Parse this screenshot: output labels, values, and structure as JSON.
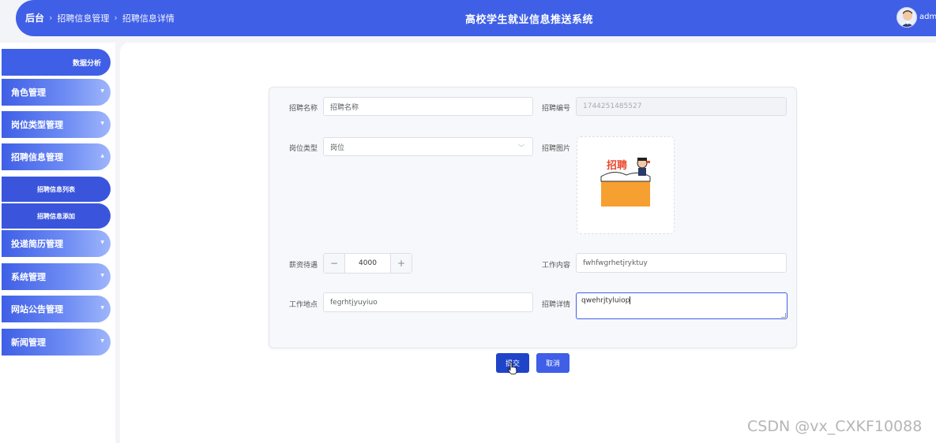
{
  "header": {
    "breadcrumb": [
      "后台",
      "招聘信息管理",
      "招聘信息详情"
    ],
    "title": "高校学生就业信息推送系统",
    "user": "admin"
  },
  "sidebar": {
    "top_item": "数据分析",
    "items": [
      {
        "label": "角色管理",
        "arrow": "▼"
      },
      {
        "label": "岗位类型管理",
        "arrow": "▼"
      },
      {
        "label": "招聘信息管理",
        "arrow": "▲",
        "children": [
          "招聘信息列表",
          "招聘信息添加"
        ]
      },
      {
        "label": "投递简历管理",
        "arrow": "▼"
      },
      {
        "label": "系统管理",
        "arrow": "▼"
      },
      {
        "label": "网站公告管理",
        "arrow": "▼"
      },
      {
        "label": "新闻管理",
        "arrow": "▼"
      }
    ]
  },
  "form": {
    "name_label": "招聘名称",
    "name_value": "招聘名称",
    "code_label": "招聘编号",
    "code_value": "1744251485527",
    "type_label": "岗位类型",
    "type_value": "岗位",
    "image_label": "招聘图片",
    "image_text": "招聘",
    "salary_label": "薪资待遇",
    "salary_value": "4000",
    "minus": "−",
    "plus": "+",
    "content_label": "工作内容",
    "content_value": "fwhfwgrhetjryktuy",
    "location_label": "工作地点",
    "location_value": "fegrhtjyuyiuo",
    "detail_label": "招聘详情",
    "detail_value": "qwehrjtyluiop"
  },
  "actions": {
    "submit": "提交",
    "cancel": "取消"
  },
  "watermark": "CSDN @vx_CXKF10088",
  "colors": {
    "primary": "#3f5fe6",
    "submit": "#1f44c8",
    "image_bg": "#f7a032"
  }
}
